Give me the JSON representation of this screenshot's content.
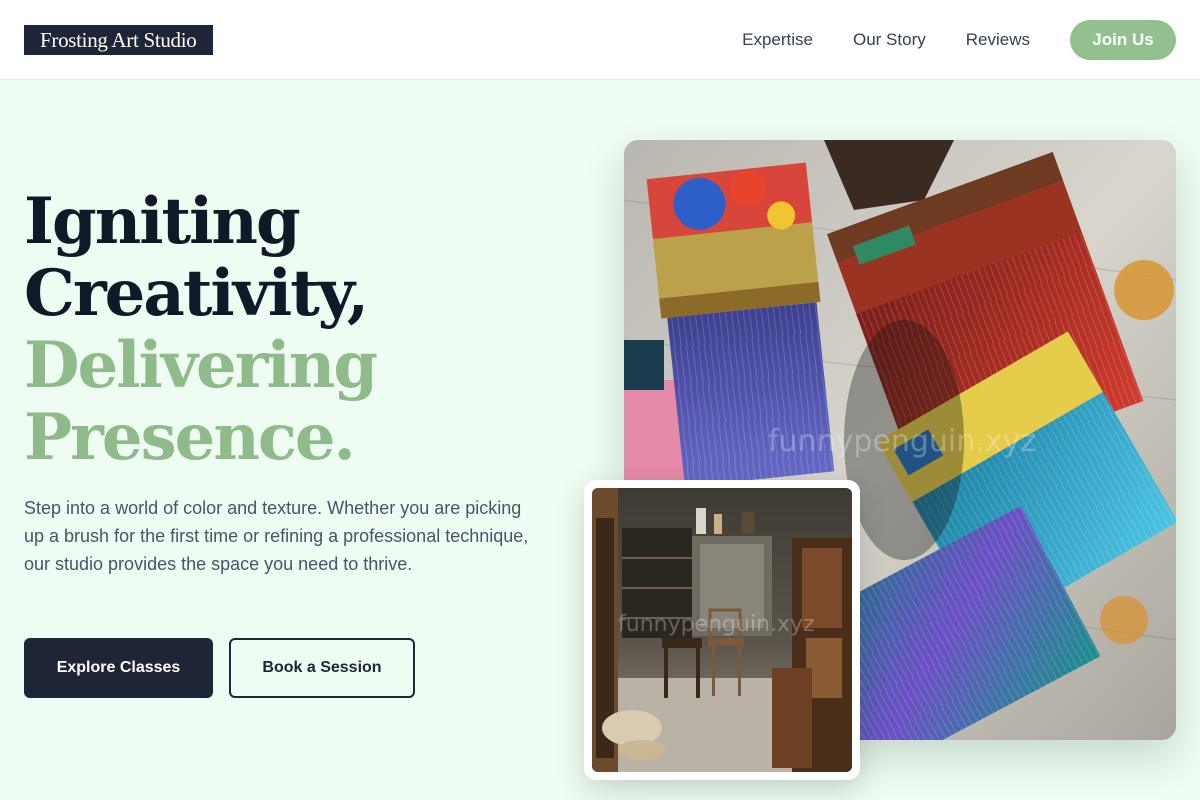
{
  "header": {
    "logo": "Frosting Art Studio",
    "nav": [
      "Expertise",
      "Our Story",
      "Reviews"
    ],
    "cta": "Join Us"
  },
  "hero": {
    "headline": {
      "line1": "Igniting",
      "line2": "Creativity,",
      "line3": "Delivering",
      "line4": "Presence."
    },
    "description": "Step into a world of color and texture. Whether you are picking up a brush for the first time or refining a professional technique, our studio provides the space you need to thrive.",
    "primary_button": "Explore Classes",
    "secondary_button": "Book a Session"
  },
  "images": {
    "main_watermark": "funnypenguin.xyz",
    "inset_watermark": "funnypenguin.xyz"
  },
  "colors": {
    "background": "#effcf1",
    "dark": "#1e2536",
    "accent": "#8fbb8b",
    "button_green": "#93c08f"
  }
}
